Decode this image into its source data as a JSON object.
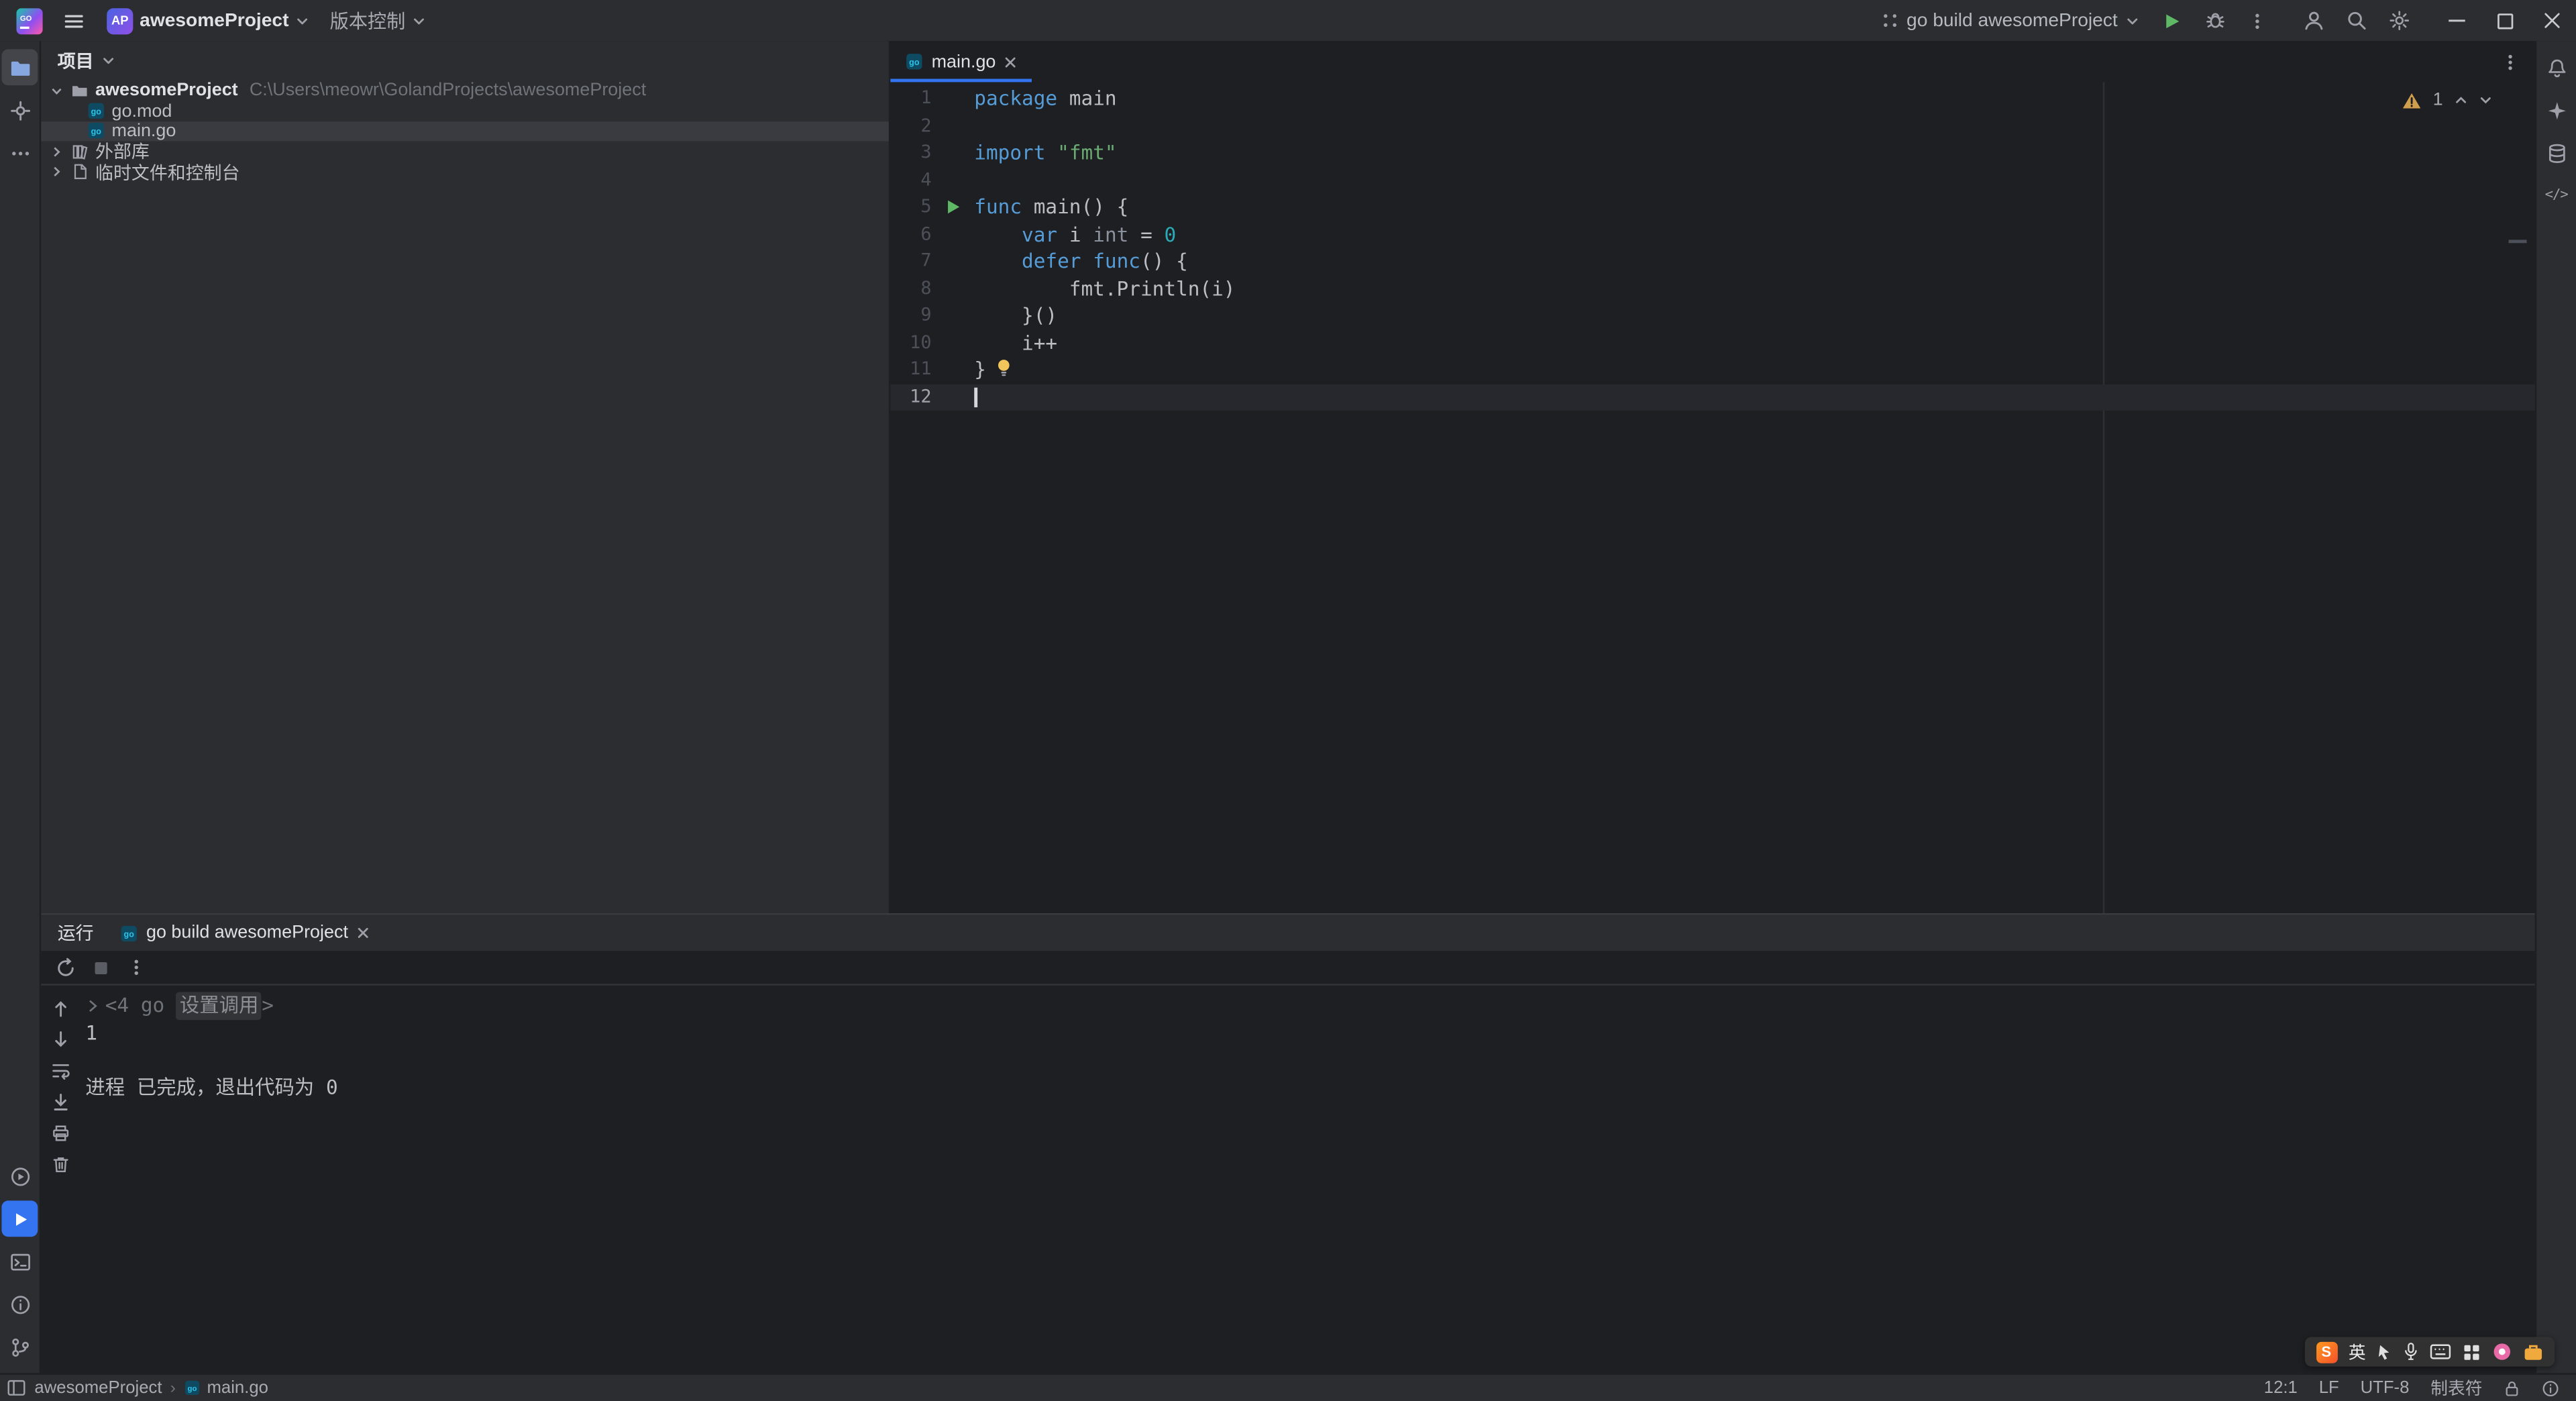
{
  "colors": {
    "accent": "#3574f0",
    "keyword": "#569cd6",
    "string": "#6aab73",
    "number": "#2aacb8",
    "run_green": "#5fb865",
    "warning_yellow": "#d6ae58"
  },
  "titlebar": {
    "project_badge": "AP",
    "project_name": "awesomeProject",
    "vcs_label": "版本控制",
    "run_config_label": "go build awesomeProject"
  },
  "activity_bar_left": {
    "top": [
      "project",
      "commit",
      "more-tool-windows"
    ],
    "bottom": [
      "services",
      "run",
      "terminal",
      "problems",
      "version-control"
    ]
  },
  "activity_bar_right": [
    "notifications",
    "ai-assistant",
    "database",
    "endpoints"
  ],
  "icons": {
    "code_tag": "</>"
  },
  "project_panel": {
    "title": "项目",
    "tree": [
      {
        "label": "awesomeProject",
        "path": "C:\\Users\\meowr\\GolandProjects\\awesomeProject"
      },
      {
        "label": "go.mod"
      },
      {
        "label": "main.go"
      },
      {
        "label": "外部库"
      },
      {
        "label": "临时文件和控制台"
      }
    ]
  },
  "editor": {
    "tab_label": "main.go",
    "warning_count": "1",
    "lines": [
      {
        "n": "1",
        "seg": [
          {
            "t": "package",
            "c": "kw"
          },
          {
            "t": " main",
            "c": "pl"
          }
        ]
      },
      {
        "n": "2",
        "seg": []
      },
      {
        "n": "3",
        "seg": [
          {
            "t": "import",
            "c": "kw"
          },
          {
            "t": " ",
            "c": "pl"
          },
          {
            "t": "\"fmt\"",
            "c": "str"
          }
        ]
      },
      {
        "n": "4",
        "seg": []
      },
      {
        "n": "5",
        "run": true,
        "seg": [
          {
            "t": "func",
            "c": "kw"
          },
          {
            "t": " main() {",
            "c": "pl"
          }
        ]
      },
      {
        "n": "6",
        "seg": [
          {
            "t": "    ",
            "c": "pl"
          },
          {
            "t": "var",
            "c": "kw"
          },
          {
            "t": " i ",
            "c": "pl"
          },
          {
            "t": "int",
            "c": "ty"
          },
          {
            "t": " = ",
            "c": "pl"
          },
          {
            "t": "0",
            "c": "num"
          }
        ]
      },
      {
        "n": "7",
        "seg": [
          {
            "t": "    ",
            "c": "pl"
          },
          {
            "t": "defer",
            "c": "kw"
          },
          {
            "t": " ",
            "c": "pl"
          },
          {
            "t": "func",
            "c": "kw"
          },
          {
            "t": "() {",
            "c": "pl"
          }
        ]
      },
      {
        "n": "8",
        "seg": [
          {
            "t": "        fmt.Println(i)",
            "c": "pl"
          }
        ]
      },
      {
        "n": "9",
        "seg": [
          {
            "t": "    }()",
            "c": "pl"
          }
        ]
      },
      {
        "n": "10",
        "seg": [
          {
            "t": "    i++",
            "c": "pl"
          }
        ]
      },
      {
        "n": "11",
        "bulb": true,
        "seg": [
          {
            "t": "}",
            "c": "pl"
          }
        ]
      },
      {
        "n": "12",
        "current": true,
        "seg": []
      }
    ]
  },
  "run_panel": {
    "tool_title": "运行",
    "tab_label": "go build awesomeProject",
    "console": [
      {
        "type": "fold",
        "pre": "<4 go ",
        "chip": "设置调用",
        "post": ">"
      },
      {
        "type": "out",
        "text": "1"
      },
      {
        "type": "blank",
        "text": ""
      },
      {
        "type": "out",
        "text": "进程 已完成，退出代码为 0"
      }
    ]
  },
  "statusbar": {
    "breadcrumb_project": "awesomeProject",
    "breadcrumb_file": "main.go",
    "caret_position": "12:1",
    "line_ending": "LF",
    "encoding": "UTF-8",
    "indent_style": "制表符"
  },
  "ime": {
    "mode_label": "英"
  }
}
